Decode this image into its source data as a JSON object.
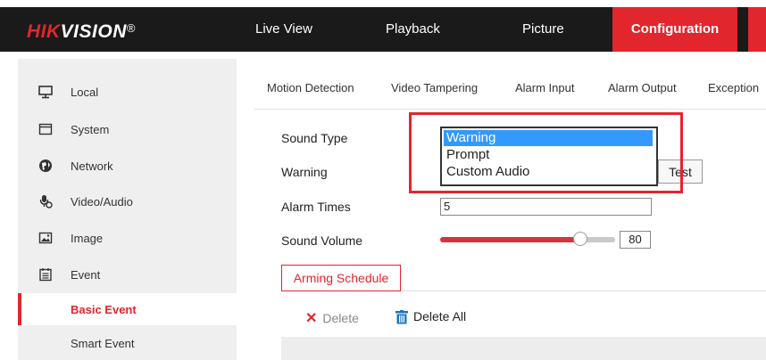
{
  "brand": {
    "name_red": "HIK",
    "name_white": "VISION",
    "reg": "®"
  },
  "topnav": [
    {
      "label": "Live View"
    },
    {
      "label": "Playback"
    },
    {
      "label": "Picture"
    },
    {
      "label": "Configuration",
      "active": true
    }
  ],
  "sidebar": {
    "items": [
      {
        "label": "Local",
        "icon": "monitor-icon"
      },
      {
        "label": "System",
        "icon": "system-icon"
      },
      {
        "label": "Network",
        "icon": "globe-icon"
      },
      {
        "label": "Video/Audio",
        "icon": "video-audio-icon"
      },
      {
        "label": "Image",
        "icon": "image-icon"
      },
      {
        "label": "Event",
        "icon": "event-icon"
      }
    ],
    "subitems": [
      {
        "label": "Basic Event",
        "active": true
      },
      {
        "label": "Smart Event"
      }
    ]
  },
  "tabs": [
    "Motion Detection",
    "Video Tampering",
    "Alarm Input",
    "Alarm Output",
    "Exception"
  ],
  "form": {
    "sound_type_label": "Sound Type",
    "warning_label": "Warning",
    "alarm_times_label": "Alarm Times",
    "sound_volume_label": "Sound Volume",
    "sound_type_options": [
      "Warning",
      "Prompt",
      "Custom Audio"
    ],
    "sound_type_selected": "Warning",
    "test_button": "Test",
    "alarm_times_value": "5",
    "sound_volume_value": "80",
    "sound_volume_fraction": 0.8
  },
  "arming_schedule": "Arming Schedule",
  "toolbar": {
    "delete_label": "Delete",
    "delete_all_label": "Delete All"
  },
  "colors": {
    "accent": "#e1262d",
    "topbar": "#1a1a1a",
    "selection": "#3399ff"
  }
}
